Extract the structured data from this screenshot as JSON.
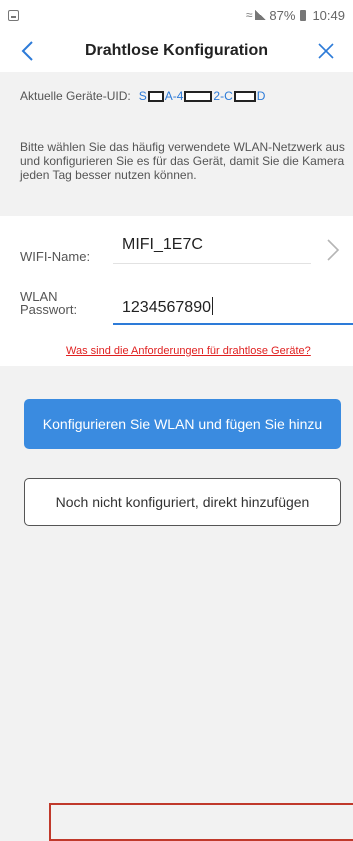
{
  "statusbar": {
    "left_icon": "image-icon",
    "signal_icons": "wifi-signal-icon",
    "battery": "87%",
    "time": "10:49"
  },
  "header": {
    "back_icon": "chevron-left-icon",
    "title": "Drahtlose Konfiguration",
    "close_icon": "close-icon"
  },
  "uid": {
    "label": "Aktuelle Geräte-UID:",
    "parts": [
      "S",
      "A-4",
      "2-C",
      "D"
    ]
  },
  "description": "Bitte wählen Sie das häufig verwendete WLAN-Netzwerk aus und konfigurieren Sie es für das Gerät, damit Sie die Kamera jeden Tag besser nutzen können.",
  "form": {
    "wifi_label": "WIFI-Name:",
    "wifi_value": "MIFI_1E7C",
    "password_label": "WLAN\nPasswort:",
    "password_value": "1234567890",
    "requirements_link": "Was sind die Anforderungen für drahtlose Geräte?"
  },
  "buttons": {
    "primary": "Konfigurieren Sie WLAN und fügen Sie hinzu",
    "secondary": "Noch nicht konfiguriert, direkt hinzufügen"
  },
  "colors": {
    "accent": "#3a8be0",
    "link_red": "#e02020",
    "focus_border": "#c0392b",
    "background": "#f2f2f2"
  }
}
